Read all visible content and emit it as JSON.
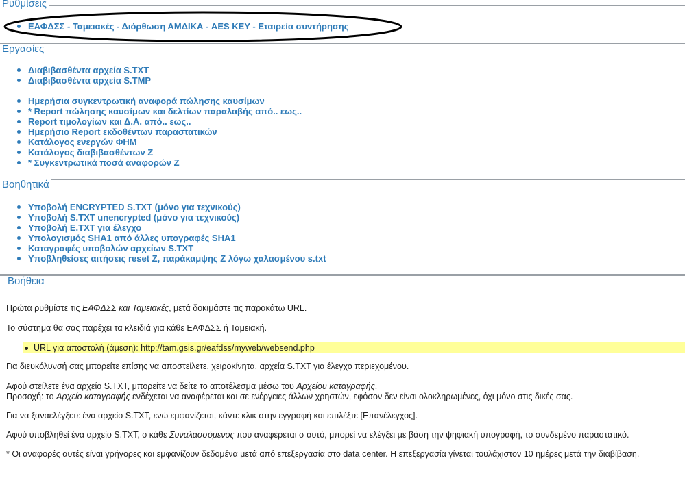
{
  "settings": {
    "heading": "Ρυθμίσεις",
    "links": [
      "ΕΑΦΔΣΣ - Ταμειακές - Διόρθωση ΑΜΔΙΚΑ - AES KEY - Εταιρεία συντήρησης"
    ]
  },
  "tasks": {
    "heading": "Εργασίες",
    "group1": [
      "Διαβιβασθέντα αρχεία S.TXT",
      "Διαβιβασθέντα αρχεία S.TMP"
    ],
    "group2": [
      "Ημερήσια συγκεντρωτική αναφορά πώλησης καυσίμων",
      "* Report πώλησης καυσίμων και δελτίων παραλαβής από.. εως..",
      "Report τιμολογίων και Δ.Α. από.. εως..",
      "Ημερήσιο Report εκδοθέντων παραστατικών",
      "Κατάλογος ενεργών ΦΗΜ",
      "Κατάλογος διαβιβασθέντων Ζ",
      "* Συγκεντρωτικά ποσά αναφορών Ζ"
    ]
  },
  "tools": {
    "heading": "Βοηθητικά",
    "links": [
      "Υποβολή ENCRYPTED S.TXT (μόνο για τεχνικούς)",
      "Υποβολή S.TXT unencrypted (μόνο για τεχνικούς)",
      "Υποβολή E.TXT για έλεγχο",
      "Υπολογισμός SHA1 από άλλες υπογραφές SHA1",
      "Καταγραφές υποβολών αρχείων S.TXT",
      "Υποβληθείσες αιτήσεις reset Z, παράκαμψης Z λόγω χαλασμένου s.txt"
    ]
  },
  "help": {
    "heading": "Βοήθεια",
    "p1_a": "Πρώτα ρυθμίστε τις ",
    "p1_b": "ΕΑΦΔΣΣ και Ταμειακές",
    "p1_c": ", μετά δοκιμάστε τις παρακάτω URL.",
    "p2": "Το σύστημα θα σας παρέχει τα κλειδιά για κάθε ΕΑΦΔΣΣ ή Ταμειακή.",
    "url_line": "URL για αποστολή (άμεση): http://tam.gsis.gr/eafdss/myweb/websend.php",
    "p3": "Για διευκόλυνσή σας μπορείτε επίσης να αποστείλετε, χειροκίνητα, αρχεία S.TXT για έλεγχο περιεχομένου.",
    "p4_a": "Αφού στείλετε ένα αρχείο S.TXT, μπορείτε να δείτε το αποτέλεσμα μέσω του ",
    "p4_b": "Αρχείου καταγραφής",
    "p4_c": ".",
    "p5_a": "Προσοχή: το ",
    "p5_b": "Αρχείο καταγραφής",
    "p5_c": " ενδέχεται να αναφέρεται και σε ενέργειες άλλων χρηστών, εφόσον δεν είναι ολοκληρωμένες, όχι μόνο στις δικές σας.",
    "p6": "Για να ξαναελέγξετε ένα αρχείο S.TXT, ενώ εμφανίζεται, κάντε κλικ στην εγγραφή και επιλέξτε [Επανέλεγχος].",
    "p7_a": "Αφού υποβληθεί ένα αρχείο S.TXT, ο κάθε ",
    "p7_b": "Συναλασσόμενος",
    "p7_c": " που αναφέρεται σ αυτό, μπορεί να ελέγξει με βάση την ψηφιακή υπογραφή, το συνδεμένο παραστατικό.",
    "p8": "* Οι αναφορές αυτές είναι γρήγορες και εμφανίζουν δεδομένα μετά από επεξεργασία στο data center. Η επεξεργασία γίνεται τουλάχιστον 10 ημέρες μετά την διαβίβαση."
  },
  "colors": {
    "link": "#2e7bb8",
    "highlight": "#ffff99",
    "rule": "#9aa0a6"
  }
}
